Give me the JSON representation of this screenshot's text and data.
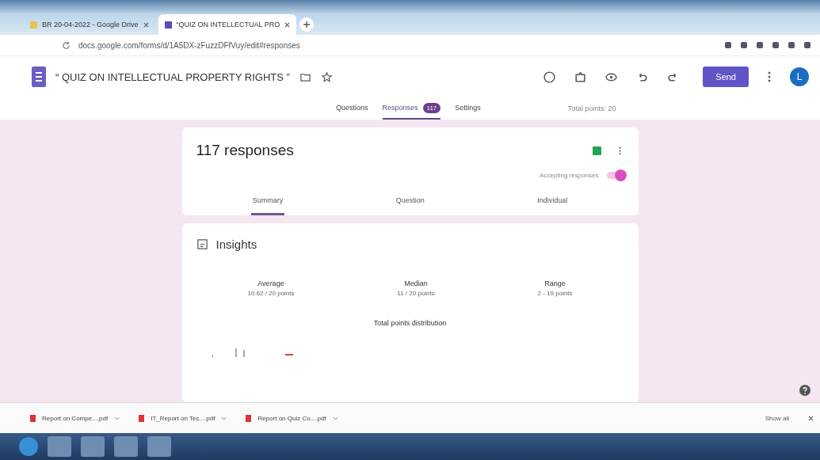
{
  "browser_tabs": [
    {
      "title": "BR 20-04-2022 - Google Drive",
      "selected": false
    },
    {
      "title": "“QUIZ ON INTELLECTUAL PRO",
      "selected": true
    }
  ],
  "address_bar": {
    "url": "docs.google.com/forms/d/1A5DX-zFuzzDFfVuy/edit#responses"
  },
  "form_header": {
    "title": "“ QUIZ ON INTELLECTUAL PROPERTY RIGHTS ”",
    "send_label": "Send",
    "avatar_letter": "L"
  },
  "form_tabs": [
    {
      "label": "Questions",
      "selected": false
    },
    {
      "label": "Responses",
      "selected": true,
      "badge": "117"
    },
    {
      "label": "Settings",
      "selected": false
    }
  ],
  "total_points": "Total points: 20",
  "responses_card": {
    "count": "117 responses",
    "accepting_label": "Accepting responses",
    "accepting": true
  },
  "view_tabs": [
    {
      "label": "Summary",
      "selected": true
    },
    {
      "label": "Question",
      "selected": false
    },
    {
      "label": "Individual",
      "selected": false
    }
  ],
  "insights": {
    "title": "Insights",
    "stats": [
      {
        "label": "Average",
        "value": "10.62 / 20 points"
      },
      {
        "label": "Median",
        "value": "11 / 20 points"
      },
      {
        "label": "Range",
        "value": "2 - 19 points"
      }
    ],
    "chart_title": "Total points distribution"
  },
  "downloads": [
    {
      "name": "Report on Compe....pdf"
    },
    {
      "name": "IT_Report on Tec....pdf"
    },
    {
      "name": "Report on Quiz Co....pdf"
    }
  ],
  "show_all": "Show all"
}
